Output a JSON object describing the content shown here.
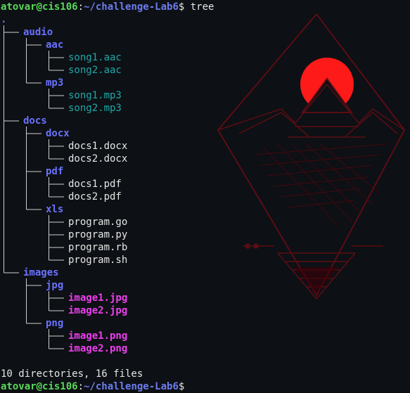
{
  "prompt": {
    "user_host": "atovar@cis106",
    "separator": ":",
    "path": "~/challenge-Lab6",
    "symbol": "$ ",
    "command": "tree"
  },
  "tree": {
    "root": ".",
    "audio": "audio",
    "aac": "aac",
    "song1_aac": "song1.aac",
    "song2_aac": "song2.aac",
    "mp3": "mp3",
    "song1_mp3": "song1.mp3",
    "song2_mp3": "song2.mp3",
    "docs": "docs",
    "docx": "docx",
    "docs1_docx": "docs1.docx",
    "docs2_docx": "docs2.docx",
    "pdf": "pdf",
    "docs1_pdf": "docs1.pdf",
    "docs2_pdf": "docs2.pdf",
    "xls": "xls",
    "program_go": "program.go",
    "program_py": "program.py",
    "program_rb": "program.rb",
    "program_sh": "program.sh",
    "images": "images",
    "jpg": "jpg",
    "image1_jpg": "image1.jpg",
    "image2_jpg": "image2.jpg",
    "png": "png",
    "image1_png": "image1.png",
    "image2_png": "image2.png"
  },
  "summary": "10 directories, 16 files",
  "colors": {
    "directory": "#6a72ff",
    "audio_file": "#1fa8a8",
    "image_file": "#ef3ef0",
    "prompt_user": "#5ad85a",
    "wallpaper_accent": "#ff1a1a"
  }
}
